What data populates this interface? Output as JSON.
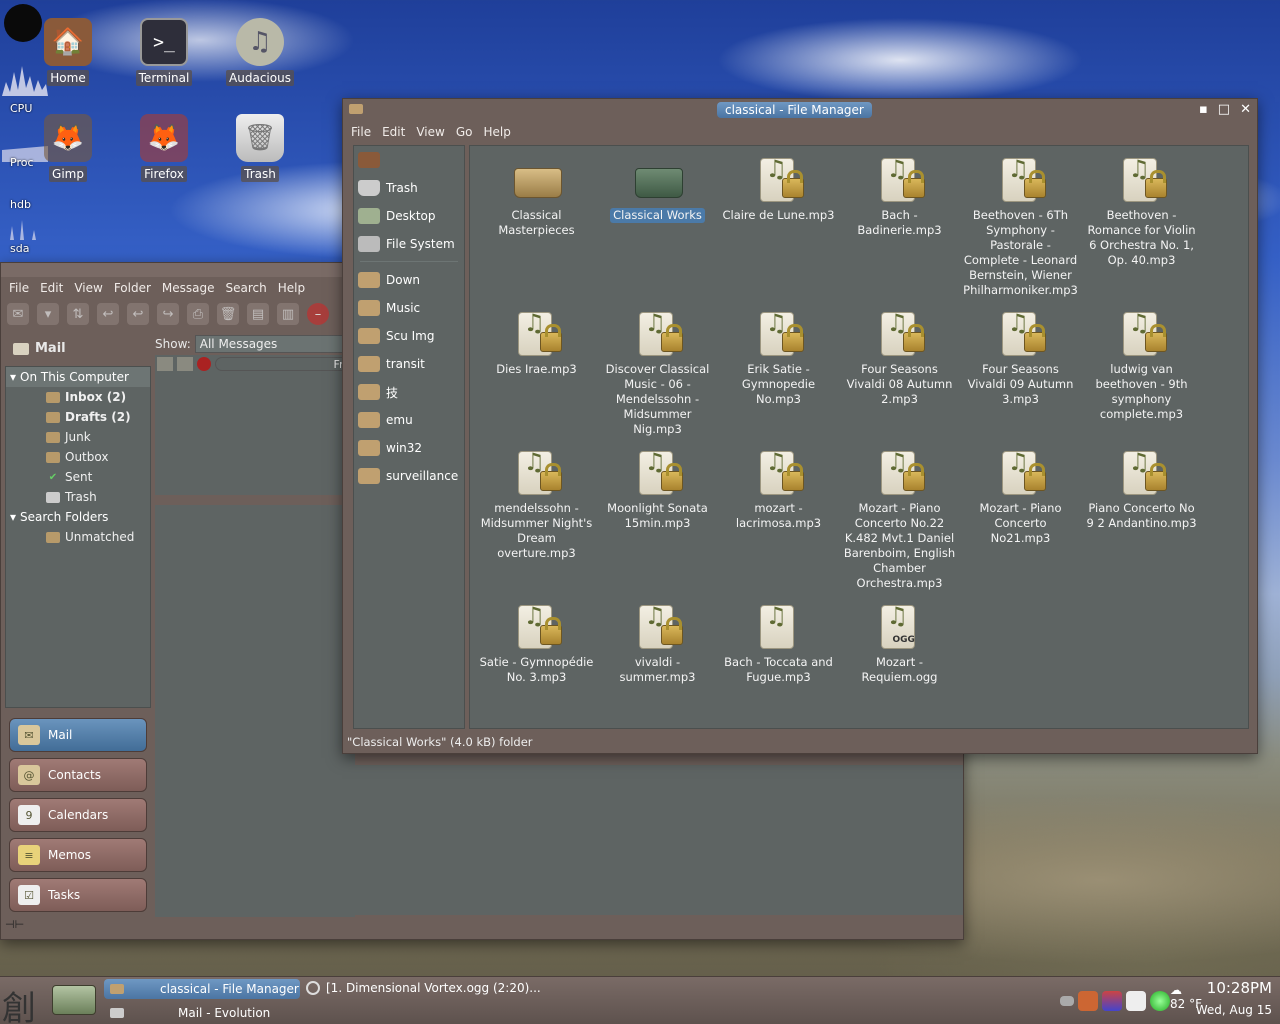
{
  "desktop": {
    "icons": [
      {
        "label": "Home",
        "glyph": "🏠",
        "icon": "home-icon"
      },
      {
        "label": "Terminal",
        "glyph": ">_",
        "icon": "terminal-icon"
      },
      {
        "label": "Audacious",
        "glyph": "♫",
        "icon": "audacious-icon"
      },
      {
        "label": "Gimp",
        "glyph": "🦊",
        "icon": "gimp-icon"
      },
      {
        "label": "Firefox",
        "glyph": "🦊",
        "icon": "firefox-icon"
      },
      {
        "label": "Trash",
        "glyph": "🗑",
        "icon": "trash-icon"
      }
    ],
    "monitors": {
      "cpu": "CPU",
      "proc": "Proc",
      "hdb": "hdb",
      "sda": "sda"
    }
  },
  "evolution": {
    "menu": [
      "File",
      "Edit",
      "View",
      "Folder",
      "Message",
      "Search",
      "Help"
    ],
    "mail_header": "Mail",
    "show_label": "Show:",
    "show_value": "All Messages",
    "col_from": "Fro",
    "groups": {
      "on_this_computer": "On This Computer",
      "search_folders": "Search Folders"
    },
    "folders": [
      {
        "label": "Inbox (2)",
        "bold": true
      },
      {
        "label": "Drafts (2)",
        "bold": true
      },
      {
        "label": "Junk",
        "bold": false
      },
      {
        "label": "Outbox",
        "bold": false
      },
      {
        "label": "Sent",
        "bold": false
      },
      {
        "label": "Trash",
        "bold": false
      }
    ],
    "search_folders": [
      {
        "label": "Unmatched"
      }
    ],
    "switcher": [
      {
        "label": "Mail",
        "active": true
      },
      {
        "label": "Contacts",
        "active": false
      },
      {
        "label": "Calendars",
        "active": false
      },
      {
        "label": "Memos",
        "active": false
      },
      {
        "label": "Tasks",
        "active": false
      }
    ],
    "calendar_day": "9"
  },
  "file_manager": {
    "title": "classical - File Manager",
    "menu": [
      "File",
      "Edit",
      "View",
      "Go",
      "Help"
    ],
    "sidebar": [
      {
        "label": ""
      },
      {
        "label": "Trash"
      },
      {
        "label": "Desktop"
      },
      {
        "label": "File System"
      },
      {
        "label": "Down"
      },
      {
        "label": "Music"
      },
      {
        "label": "Scu Img"
      },
      {
        "label": "transit"
      },
      {
        "label": "技"
      },
      {
        "label": "emu"
      },
      {
        "label": "win32"
      },
      {
        "label": "surveillance"
      }
    ],
    "files": [
      {
        "name": "Classical Masterpieces",
        "type": "folder"
      },
      {
        "name": "Classical Works",
        "type": "folder-dark",
        "selected": true
      },
      {
        "name": "Claire de Lune.mp3",
        "type": "locked"
      },
      {
        "name": "Bach - Badinerie.mp3",
        "type": "locked"
      },
      {
        "name": "Beethoven - 6Th Symphony - Pastorale - Complete - Leonard Bernstein, Wiener Philharmoniker.mp3",
        "type": "locked"
      },
      {
        "name": "Beethoven - Romance for Violin 6 Orchestra No. 1, Op. 40.mp3",
        "type": "locked"
      },
      {
        "name": "Dies Irae.mp3",
        "type": "locked"
      },
      {
        "name": "Discover Classical Music - 06 - Mendelssohn - Midsummer Nig.mp3",
        "type": "locked"
      },
      {
        "name": "Erik Satie - Gymnopedie No.mp3",
        "type": "locked"
      },
      {
        "name": "Four Seasons Vivaldi 08 Autumn 2.mp3",
        "type": "locked"
      },
      {
        "name": "Four Seasons Vivaldi 09 Autumn 3.mp3",
        "type": "locked"
      },
      {
        "name": "ludwig van beethoven - 9th symphony complete.mp3",
        "type": "locked"
      },
      {
        "name": "mendelssohn - Midsummer Night's Dream overture.mp3",
        "type": "locked"
      },
      {
        "name": "Moonlight Sonata 15min.mp3",
        "type": "locked"
      },
      {
        "name": "mozart - lacrimosa.mp3",
        "type": "locked"
      },
      {
        "name": "Mozart - Piano Concerto No.22 K.482 Mvt.1 Daniel Barenboim, English Chamber Orchestra.mp3",
        "type": "locked"
      },
      {
        "name": "Mozart - Piano Concerto No21.mp3",
        "type": "locked"
      },
      {
        "name": "Piano Concerto No 9 2 Andantino.mp3",
        "type": "locked"
      },
      {
        "name": "Satie - Gymnopédie No. 3.mp3",
        "type": "locked"
      },
      {
        "name": "vivaldi - summer.mp3",
        "type": "locked"
      },
      {
        "name": "Bach - Toccata and Fugue.mp3",
        "type": "audio"
      },
      {
        "name": "Mozart - Requiem.ogg",
        "type": "ogg"
      }
    ],
    "ogg_label": "OGG",
    "status": "\"Classical Works\" (4.0 kB) folder"
  },
  "taskbar": {
    "tasks": [
      {
        "label": "classical - File Manager",
        "active": true
      },
      {
        "label": "Mail - Evolution",
        "active": false
      }
    ],
    "media": "[1. Dimensional Vortex.ogg (2:20)...",
    "temp": "82 °F",
    "time": "10:28PM",
    "date": "Wed, Aug 15"
  }
}
